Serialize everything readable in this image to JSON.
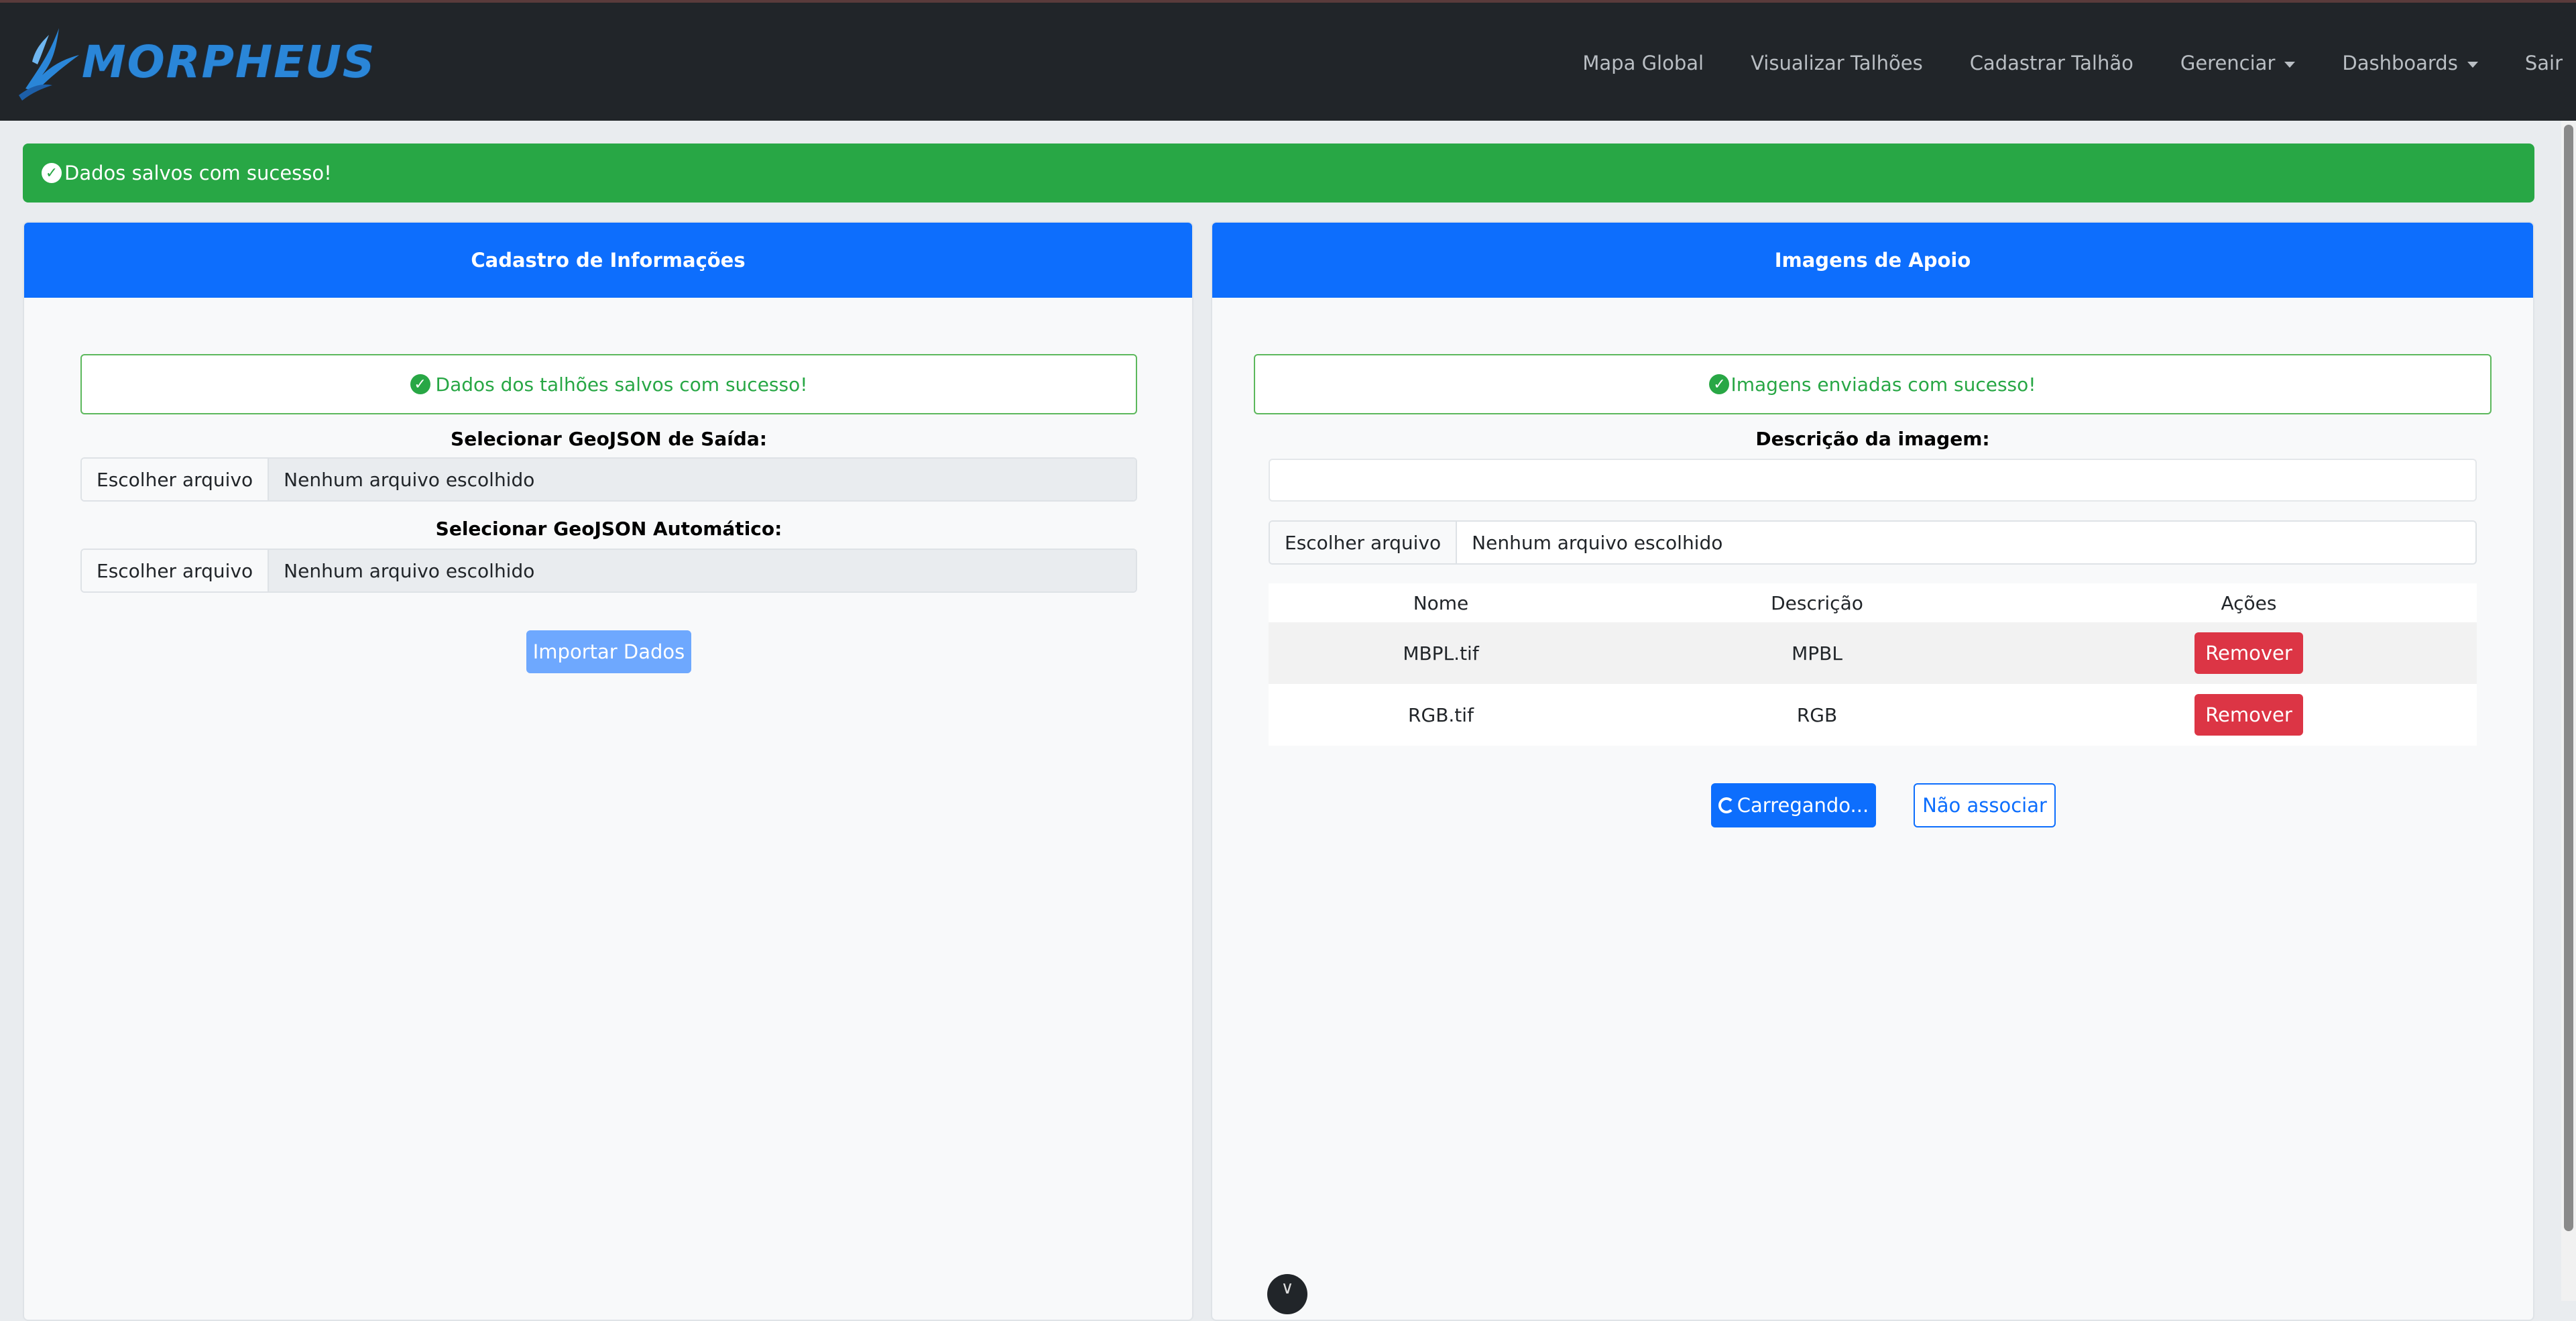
{
  "app": {
    "brand": "MORPHEUS"
  },
  "nav": {
    "links": [
      "Mapa Global",
      "Visualizar Talhões",
      "Cadastrar Talhão"
    ],
    "gerenciar": "Gerenciar",
    "dashboards": "Dashboards",
    "sair": "Sair"
  },
  "alert": {
    "message": "Dados salvos com sucesso!"
  },
  "left": {
    "title": "Cadastro de Informações",
    "notice": "Dados dos talhões salvos com sucesso!",
    "label_saida": "Selecionar GeoJSON de Saída:",
    "label_auto": "Selecionar GeoJSON Automático:",
    "file_button": "Escolher arquivo",
    "file_empty": "Nenhum arquivo escolhido",
    "import_button": "Importar Dados"
  },
  "right": {
    "title": "Imagens de Apoio",
    "notice": "Imagens enviadas com sucesso!",
    "label_desc": "Descrição da imagem:",
    "desc_value": "",
    "file_button": "Escolher arquivo",
    "file_empty": "Nenhum arquivo escolhido",
    "table": {
      "headers": [
        "Nome",
        "Descrição",
        "Ações"
      ],
      "rows": [
        {
          "nome": "MBPL.tif",
          "descricao": "MPBL",
          "acao": "Remover"
        },
        {
          "nome": "RGB.tif",
          "descricao": "RGB",
          "acao": "Remover"
        }
      ]
    },
    "loading_button": "Carregando...",
    "skip_button": "Não associar"
  },
  "colors": {
    "navbar": "#212529",
    "primary": "#0d6efd",
    "success": "#28a745",
    "danger": "#dc3545"
  },
  "icons": {
    "logo": "phoenix-logo-icon",
    "success": "check-circle-icon",
    "loading": "spinner-icon",
    "bottom": "chevron-down-icon"
  }
}
